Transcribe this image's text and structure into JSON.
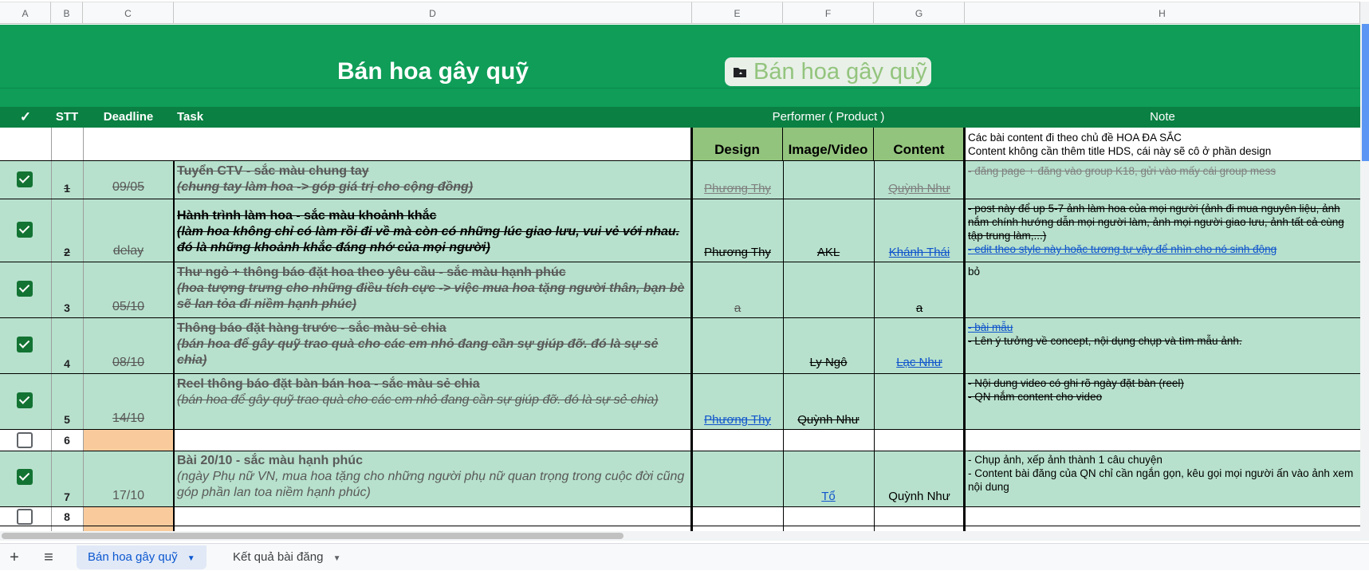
{
  "columns": [
    "A",
    "B",
    "C",
    "D",
    "E",
    "F",
    "G",
    "H"
  ],
  "title": "Bán hoa gây quỹ",
  "chip_label": "Bán hoa gây quỹ",
  "header": {
    "check": "✓",
    "stt": "STT",
    "deadline": "Deadline",
    "task": "Task",
    "performer": "Performer ( Product )",
    "note": "Note"
  },
  "subheader": {
    "design": "Design",
    "image_video": "Image/Video",
    "content": "Content",
    "note_line1": "Các bài content đi theo chủ đề HOA ĐA SẮC",
    "note_line2": "Content không cần thêm title HDS, cái này sẽ cô ở phần design"
  },
  "rows": [
    {
      "num": "1",
      "deadline": "09/05",
      "task_title": "Tuyển CTV - sắc màu chung tay",
      "task_sub": "(chung tay làm hoa -> góp giá trị cho cộng đồng)",
      "design": "Phương Thy",
      "image": "",
      "content": "Quỳnh Như",
      "note": "- đăng page + đăng vào group K18, gửi vào mấy cái group mess"
    },
    {
      "num": "2",
      "deadline": "delay",
      "task_title": "Hành trình làm hoa - sắc màu khoảnh khắc",
      "task_sub": "(làm hoa không chỉ có làm rồi đi về mà còn có những lúc giao lưu, vui vẻ với nhau. đó là những khoảnh khắc đáng nhớ của mọi người)",
      "design": "Phương Thy",
      "image": "AKL",
      "content": "Khánh Thái",
      "note": "- post này để up 5-7 ảnh làm hoa của mọi người (ảnh đi mua nguyên liệu, ảnh nắm chính hướng dẫn mọi người làm, ảnh mọi người giao lưu, ảnh tất cả cùng tập trung làm,...)",
      "note2": "- edit theo style này hoặc tương tự vậy để nhìn cho nó sinh động"
    },
    {
      "num": "3",
      "deadline": "05/10",
      "task_title": "Thư ngỏ + thông báo đặt hoa theo yêu cầu - sắc màu hạnh phúc",
      "task_sub": "(hoa tượng trưng cho những điều tích cực -> việc mua hoa tặng người thân, bạn bè sẽ lan tỏa đi niềm hạnh phúc)",
      "design": "a",
      "image": "",
      "content": "a",
      "note": "bỏ"
    },
    {
      "num": "4",
      "deadline": "08/10",
      "task_title": "Thông báo đặt hàng trước - sắc màu sẻ chia",
      "task_sub": "(bán hoa để gây quỹ trao quà cho các em nhỏ đang cần sự giúp đỡ. đó là sự sẻ chia)",
      "design": "",
      "image": "Ly Ngô",
      "content": "Lạc Như",
      "note": "- bài mẫu",
      "note2": "- Lên ý tưởng về concept, nội dụng chụp và tìm mẫu ảnh."
    },
    {
      "num": "5",
      "deadline": "14/10",
      "task_title": "Reel thông báo đặt bàn bán hoa - sắc màu sẻ chia",
      "task_sub": "(bán hoa để gây quỹ trao quà cho các em nhỏ đang cần sự giúp đỡ. đó là sự sẻ chia)",
      "design": "Phương Thy",
      "image": "Quỳnh Như",
      "content": "",
      "note": "- Nội dung video có ghi rõ ngày đặt bàn (reel)",
      "note2": "- QN nắm content cho video"
    },
    {
      "num": "6"
    },
    {
      "num": "7",
      "deadline": "17/10",
      "task_title": "Bài 20/10 - sắc màu hạnh phúc",
      "task_sub": "(ngày Phụ nữ VN, mua hoa tặng cho những người phụ nữ quan trọng trong cuộc đời cũng góp phần lan toa niềm hạnh phúc)",
      "design": "",
      "image": "Tổ",
      "content": "Quỳnh Như",
      "note": "- Chụp ảnh, xếp ảnh thành 1 câu chuyện",
      "note2": "- Content bài đăng của QN chỉ cần ngắn gọn, kêu gọi mọi người ấn vào ảnh xem nội dung"
    },
    {
      "num": "8"
    }
  ],
  "tabs": {
    "add": "+",
    "menu": "≡",
    "active": "Bán hoa gây quỹ",
    "other": "Kết quả bài đăng"
  },
  "colors": {
    "green": "#0f9d58",
    "dark_green": "#0b8043",
    "mint": "#b7e1cd",
    "sub_header": "#93c47d",
    "orange": "#f9cb9c",
    "check": "#137333"
  }
}
